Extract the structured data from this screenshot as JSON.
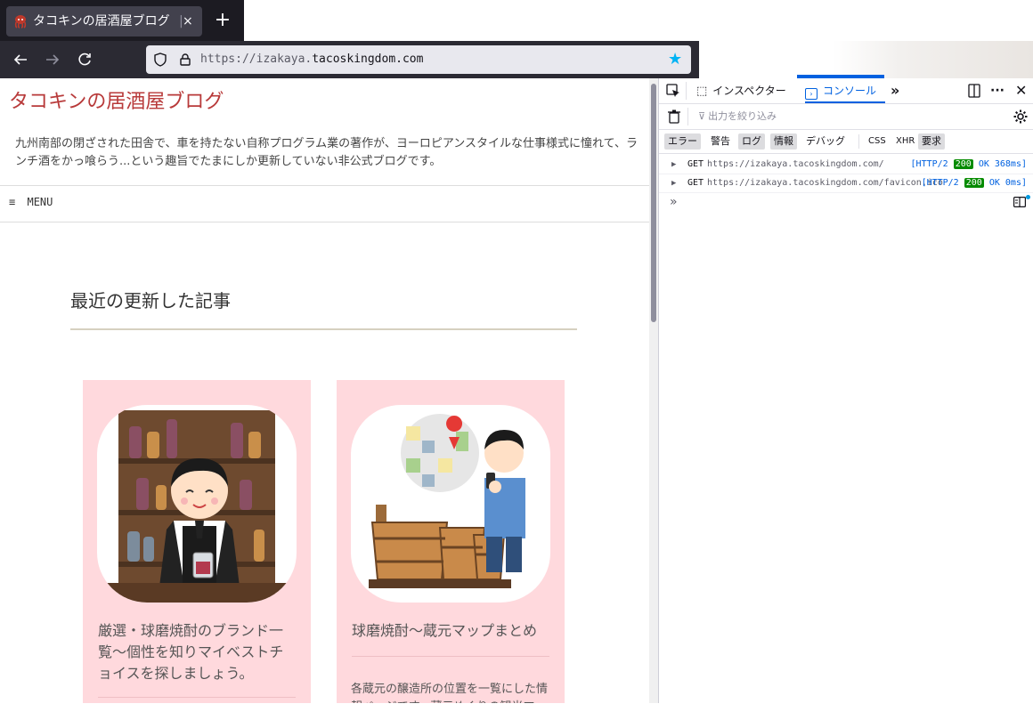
{
  "browser": {
    "tab_title": "タコキンの居酒屋ブログ",
    "tab_separator": "|",
    "tab_close": "×",
    "new_tab": "+",
    "url_prefix": "https://izakaya.",
    "url_host": "tacoskingdom.com"
  },
  "page": {
    "blog_title": "タコキンの居酒屋ブログ",
    "blog_description": "九州南部の閉ざされた田舎で、車を持たない自称プログラム業の著作が、ヨーロピアンスタイルな仕事様式に憧れて、ランチ酒をかっ喰らう...という趣旨でたまにしか更新していない非公式ブログです。",
    "menu_icon": "≡",
    "menu_label": "MENU",
    "section_title": "最近の更新した記事",
    "cards": [
      {
        "title": "厳選・球磨焼酎のブランド一覧〜個性を知りマイベストチョイスを探しましょう。",
        "excerpt": ""
      },
      {
        "title": "球磨焼酎〜蔵元マップまとめ",
        "excerpt": "各蔵元の醸造所の位置を一覧にした情報ページです。蔵元めぐりの観光マップ"
      }
    ]
  },
  "devtools": {
    "tabs": [
      "インスペクター",
      "コンソール"
    ],
    "active_tab": "コンソール",
    "filter_placeholder": "出力を絞り込み",
    "levels": [
      {
        "label": "エラー",
        "on": true
      },
      {
        "label": "警告",
        "on": false
      },
      {
        "label": "ログ",
        "on": true
      },
      {
        "label": "情報",
        "on": true
      },
      {
        "label": "デバッグ",
        "on": false
      },
      {
        "label": "CSS",
        "on": false
      },
      {
        "label": "XHR",
        "on": false
      },
      {
        "label": "要求",
        "on": true
      }
    ],
    "logs": [
      {
        "method": "GET",
        "url": "https://izakaya.tacoskingdom.com/",
        "proto": "[HTTP/2",
        "code": "200",
        "status": "OK 368ms]"
      },
      {
        "method": "GET",
        "url": "https://izakaya.tacoskingdom.com/favicon.ico",
        "proto": "[HTTP/2",
        "code": "200",
        "status": "OK 0ms]"
      }
    ],
    "prompt": "»"
  },
  "colors": {
    "accent": "#0061e0",
    "blog_title": "#b83a3a",
    "card_bg": "#ffd9dd",
    "star": "#00b3f4",
    "status_200": "#058b00"
  },
  "icons": [
    "octopus-favicon-icon",
    "close-icon",
    "plus-icon",
    "back-arrow-icon",
    "forward-arrow-icon",
    "reload-icon",
    "shield-icon",
    "lock-icon",
    "star-icon",
    "pick-element-icon",
    "inspector-icon",
    "console-icon",
    "more-tabs-icon",
    "dock-icon",
    "meatball-menu-icon",
    "close-devtools-icon",
    "trash-icon",
    "filter-icon",
    "settings-gear-icon",
    "expand-triangle-icon",
    "prompt-chevron-icon",
    "split-console-icon"
  ]
}
